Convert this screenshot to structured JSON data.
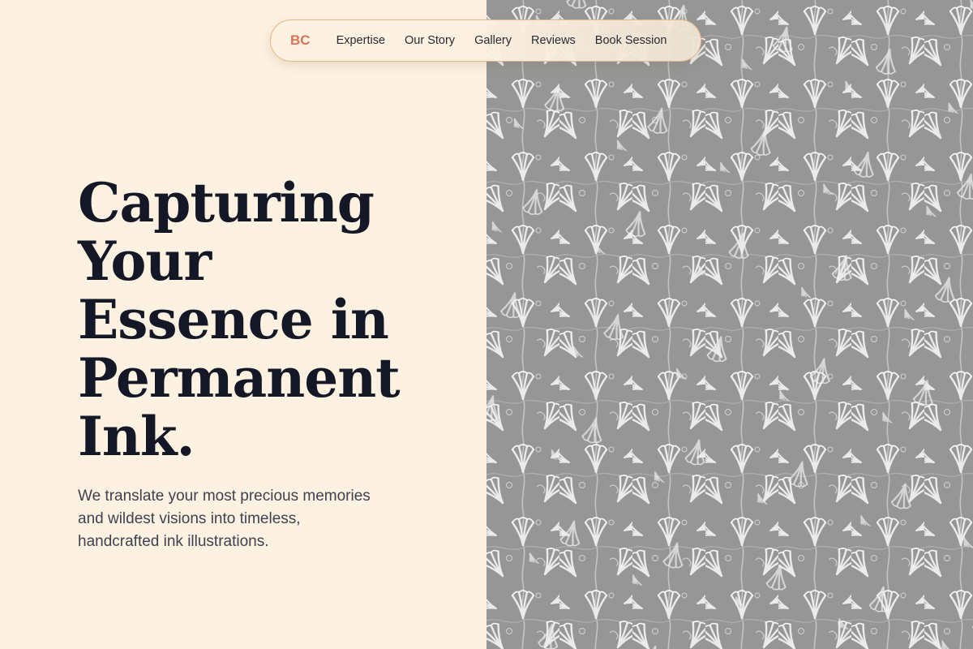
{
  "nav": {
    "logo": "BC",
    "links": [
      "Expertise",
      "Our Story",
      "Gallery",
      "Reviews",
      "Book Session"
    ]
  },
  "hero": {
    "title_lines": [
      "Capturing",
      "Your",
      "Essence in",
      "Permanent",
      "Ink."
    ],
    "subtitle_lines": [
      "We translate your most precious memories",
      "and wildest visions into timeless,",
      "handcrafted ink illustrations."
    ]
  },
  "colors": {
    "background": "#fdf1e1",
    "accent": "#d97357",
    "heading": "#141826",
    "body_text": "#3e4250",
    "nav_border": "#e0b887",
    "pattern_base": "#9a9a9a"
  },
  "icons": {
    "hero_image": "ornate-floral-engraving-pattern"
  }
}
